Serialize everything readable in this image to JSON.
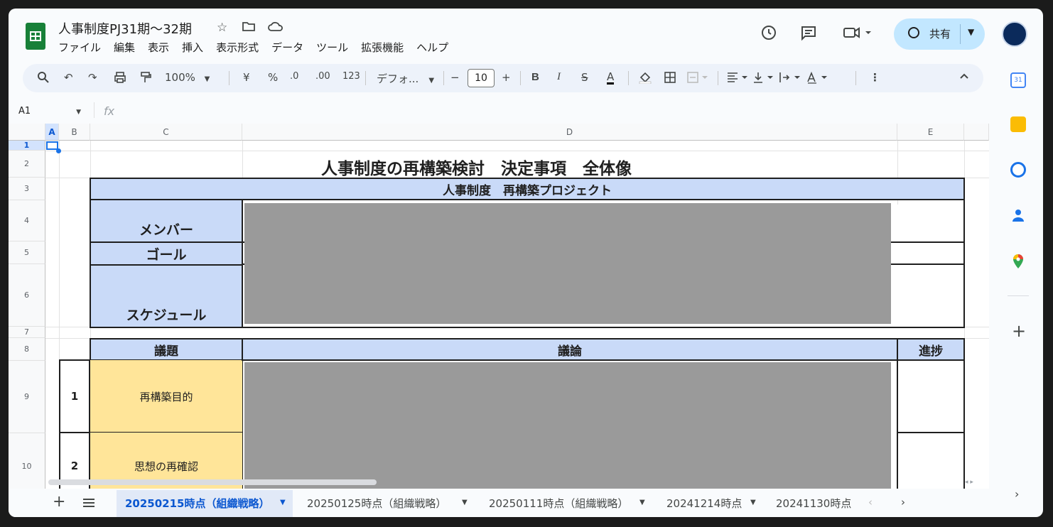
{
  "app": {
    "title": "人事制度PJ31期～32期",
    "menu": [
      "ファイル",
      "編集",
      "表示",
      "挿入",
      "表示形式",
      "データ",
      "ツール",
      "拡張機能",
      "ヘルプ"
    ],
    "share_label": "共有"
  },
  "toolbar": {
    "zoom": "100%",
    "currency": "¥",
    "percent": "%",
    "dec_decrease": ".0",
    "dec_increase": ".00",
    "number_format": "123",
    "font": "デフォ...",
    "font_size": "10",
    "bold": "B",
    "italic": "I",
    "strike": "S",
    "text_color": "A",
    "more": "⋮"
  },
  "formula_bar": {
    "name_box": "A1",
    "fx": "fx"
  },
  "columns": [
    "A",
    "B",
    "C",
    "D",
    "E"
  ],
  "rows": [
    "1",
    "2",
    "3",
    "4",
    "5",
    "6",
    "7",
    "8",
    "9",
    "10"
  ],
  "sheet": {
    "title": "人事制度の再構築検討　決定事項　全体像",
    "project_header": "人事制度　再構築プロジェクト",
    "labels": {
      "members": "メンバー",
      "goal": "ゴール",
      "schedule": "スケジュール"
    },
    "table_header": {
      "topic": "議題",
      "discussion": "議論",
      "progress": "進捗"
    },
    "items": [
      {
        "no": "1",
        "topic": "再構築目的"
      },
      {
        "no": "2",
        "topic": "思想の再確認"
      }
    ]
  },
  "sheet_tabs": [
    "20250215時点（組織戦略）",
    "20250125時点（組織戦略）",
    "20250111時点（組織戦略）",
    "20241214時点",
    "20241130時点"
  ],
  "colors": {
    "header_blue": "#c9daf8",
    "topic_yellow": "#ffe599",
    "active_tab_text": "#0b57d0"
  }
}
